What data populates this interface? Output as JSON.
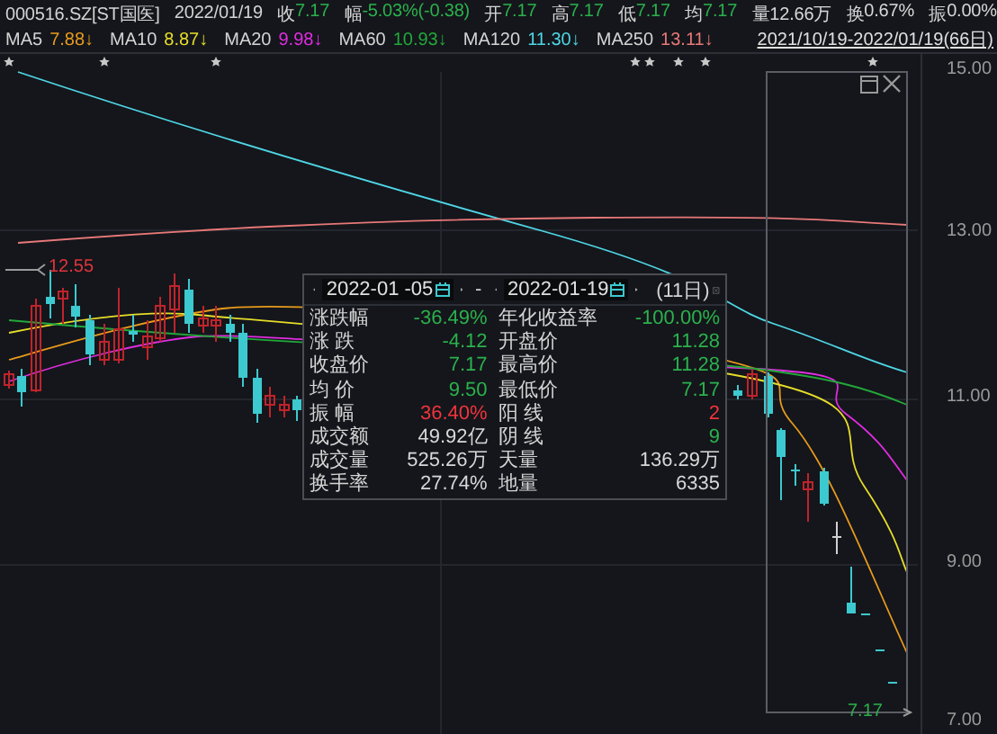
{
  "header": {
    "code": "000516.SZ[ST国医]",
    "date": "2022/01/19",
    "quotes": [
      {
        "label": "收",
        "value": "7.17",
        "color": "#2bb14c"
      },
      {
        "label": "幅",
        "value": "-5.03%(-0.38)",
        "color": "#2bb14c"
      },
      {
        "label": "开",
        "value": "7.17",
        "color": "#2bb14c"
      },
      {
        "label": "高",
        "value": "7.17",
        "color": "#2bb14c"
      },
      {
        "label": "低",
        "value": "7.17",
        "color": "#2bb14c"
      },
      {
        "label": "均",
        "value": "7.17",
        "color": "#2bb14c"
      },
      {
        "label": "量",
        "value": "12.66万",
        "color": "#d8d8d8"
      },
      {
        "label": "换",
        "value": "0.67%",
        "color": "#d8d8d8"
      },
      {
        "label": "振",
        "value": "0.00%",
        "color": "#d8d8d8"
      }
    ]
  },
  "moving_averages": [
    {
      "label": "MA5",
      "value": "7.88↓",
      "color": "#e89a1c"
    },
    {
      "label": "MA10",
      "value": "8.87↓",
      "color": "#e6dc2a"
    },
    {
      "label": "MA20",
      "value": "9.98↓",
      "color": "#e02ce0"
    },
    {
      "label": "MA60",
      "value": "10.93↓",
      "color": "#22a83a"
    },
    {
      "label": "MA120",
      "value": "11.30↓",
      "color": "#4fd6e6"
    },
    {
      "label": "MA250",
      "value": "13.11↓",
      "color": "#e87878"
    }
  ],
  "date_range": "2021/10/19-2022/01/19(66日)",
  "chart": {
    "y_axis_labels": [
      "15.00",
      "13.00",
      "11.00",
      "9.00",
      "7.00"
    ],
    "high_label": "12.55",
    "low_label": "7.17"
  },
  "interval_stats": {
    "start_date": "2022-01 -05",
    "separator": "-",
    "end_date": "2022-01-19",
    "days": "(11日)",
    "rows": [
      {
        "label": "涨跌幅",
        "value": "-36.49%",
        "color": "#2bb14c"
      },
      {
        "label": "年化收益率",
        "value": "-100.00%",
        "color": "#2bb14c"
      },
      {
        "label": "涨 跌",
        "value": "-4.12",
        "color": "#2bb14c"
      },
      {
        "label": "开盘价",
        "value": "11.28",
        "color": "#2bb14c"
      },
      {
        "label": "收盘价",
        "value": "7.17",
        "color": "#2bb14c"
      },
      {
        "label": "最高价",
        "value": "11.28",
        "color": "#2bb14c"
      },
      {
        "label": "均 价",
        "value": "9.50",
        "color": "#2bb14c"
      },
      {
        "label": "最低价",
        "value": "7.17",
        "color": "#2bb14c"
      },
      {
        "label": "振 幅",
        "value": "36.40%",
        "color": "#f0343c"
      },
      {
        "label": "阳 线",
        "value": "2",
        "color": "#f0343c"
      },
      {
        "label": "成交额",
        "value": "49.92亿",
        "color": "#d8d8d8"
      },
      {
        "label": "阴 线",
        "value": "9",
        "color": "#2bb14c"
      },
      {
        "label": "成交量",
        "value": "525.26万",
        "color": "#d8d8d8"
      },
      {
        "label": "天量",
        "value": "136.29万",
        "color": "#d8d8d8"
      },
      {
        "label": "换手率",
        "value": "27.74%",
        "color": "#d8d8d8"
      },
      {
        "label": "地量",
        "value": "6335",
        "color": "#d8d8d8"
      }
    ]
  }
}
